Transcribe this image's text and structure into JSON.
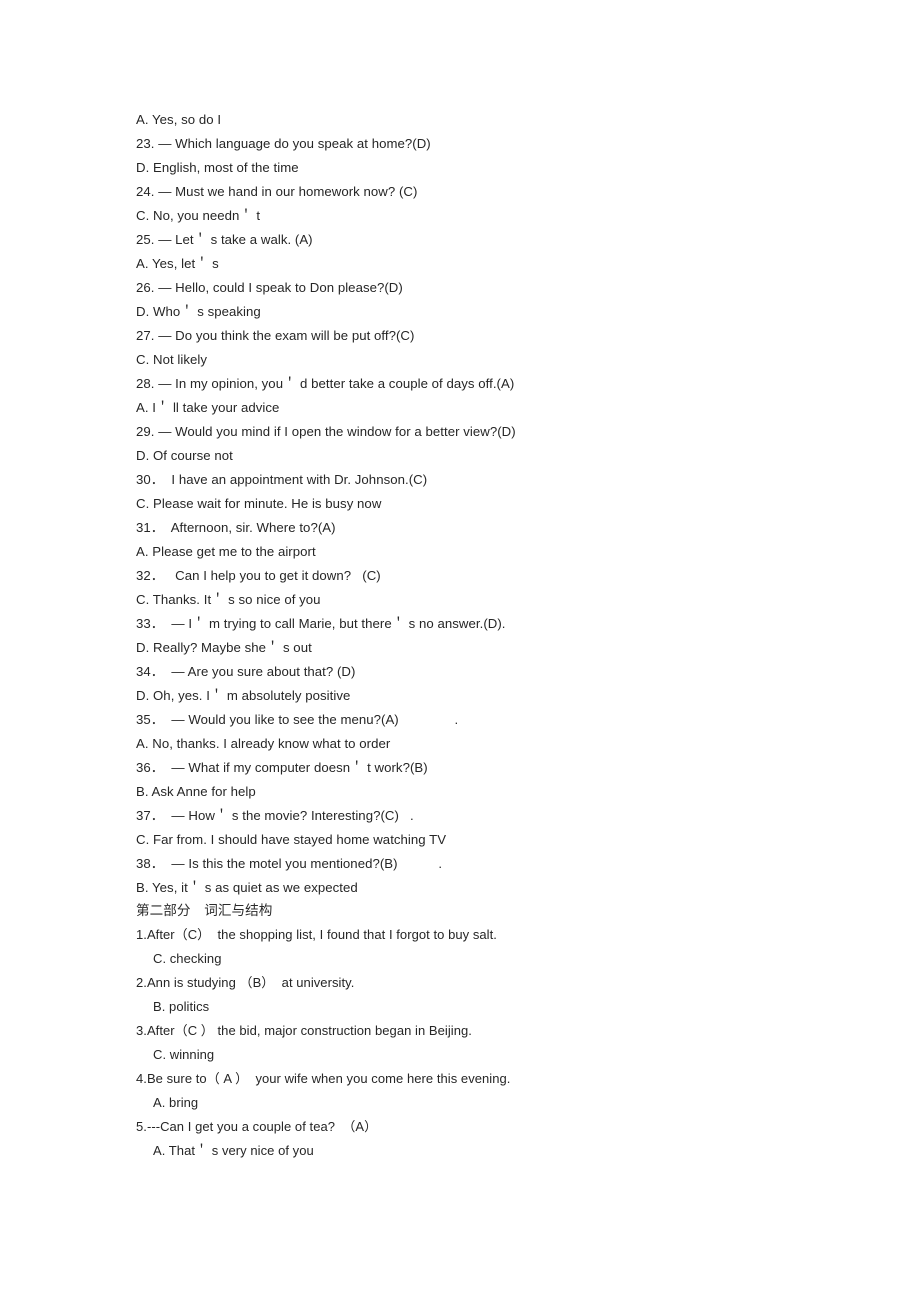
{
  "document": {
    "page_background": "#ffffff",
    "text_color": "#262626",
    "part_one_lines": [
      {
        "id": "opt-22-a",
        "text": "A. Yes, so do I",
        "kind": "option"
      },
      {
        "id": "q-23",
        "text": "23. — Which language do you speak at home?(D)",
        "kind": "question"
      },
      {
        "id": "opt-23-d",
        "text": "D. English, most of the time",
        "kind": "option"
      },
      {
        "id": "q-24",
        "text": "24. — Must we hand in our homework now? (C)",
        "kind": "question"
      },
      {
        "id": "opt-24-c",
        "text": "C. No, you needn＇ t",
        "kind": "option"
      },
      {
        "id": "q-25",
        "text": "25. — Let＇ s take a walk. (A)",
        "kind": "question"
      },
      {
        "id": "opt-25-a",
        "text": "A. Yes, let＇ s",
        "kind": "option"
      },
      {
        "id": "q-26",
        "text": "26. — Hello, could I speak to Don please?(D)",
        "kind": "question"
      },
      {
        "id": "opt-26-d",
        "text": "D. Who＇ s speaking",
        "kind": "option"
      },
      {
        "id": "q-27",
        "text": "27. — Do you think the exam will be put off?(C)",
        "kind": "question"
      },
      {
        "id": "opt-27-c",
        "text": "C. Not likely",
        "kind": "option"
      },
      {
        "id": "q-28",
        "text": "28. — In my opinion, you＇ d better take a couple of days off.(A)",
        "kind": "question"
      },
      {
        "id": "opt-28-a",
        "text": "A. I＇ ll take your advice",
        "kind": "option"
      },
      {
        "id": "q-29",
        "text": "29. — Would you mind if I open the window for a better view?(D)",
        "kind": "question"
      },
      {
        "id": "opt-29-d",
        "text": "D. Of course not",
        "kind": "option"
      },
      {
        "id": "q-30",
        "text": "30．  I have an appointment with Dr. Johnson.(C)",
        "kind": "question"
      },
      {
        "id": "opt-30-c",
        "text": "C. Please wait for minute. He is busy now",
        "kind": "option"
      },
      {
        "id": "q-31",
        "text": "31．  Afternoon, sir. Where to?(A)",
        "kind": "question"
      },
      {
        "id": "opt-31-a",
        "text": "A. Please get me to the airport",
        "kind": "option"
      },
      {
        "id": "q-32",
        "text": "32．   Can I help you to get it down?   (C)",
        "kind": "question"
      },
      {
        "id": "opt-32-c",
        "text": "C. Thanks. It＇ s so nice of you",
        "kind": "option"
      },
      {
        "id": "q-33",
        "text": "33．  — I＇ m trying to call Marie, but there＇ s no answer.(D).",
        "kind": "question"
      },
      {
        "id": "opt-33-d",
        "text": "D. Really? Maybe she＇ s out",
        "kind": "option"
      },
      {
        "id": "q-34",
        "text": "34．  — Are you sure about that? (D)",
        "kind": "question"
      },
      {
        "id": "opt-34-d",
        "text": "D. Oh, yes. I＇ m absolutely positive",
        "kind": "option"
      },
      {
        "id": "q-35",
        "text": "35．  — Would you like to see the menu?(A)               .",
        "kind": "question"
      },
      {
        "id": "opt-35-a",
        "text": "A. No, thanks. I already know what to order",
        "kind": "option"
      },
      {
        "id": "q-36",
        "text": "36．  — What if my computer doesn＇ t work?(B)",
        "kind": "question"
      },
      {
        "id": "opt-36-b",
        "text": "B. Ask Anne for help",
        "kind": "option"
      },
      {
        "id": "q-37",
        "text": "37．  — How＇ s the movie? Interesting?(C)   .",
        "kind": "question"
      },
      {
        "id": "opt-37-c",
        "text": "C. Far from. I should have stayed home watching TV",
        "kind": "option"
      },
      {
        "id": "q-38",
        "text": "38．  — Is this the motel you mentioned?(B)           .",
        "kind": "question"
      },
      {
        "id": "opt-38-b",
        "text": "B. Yes, it＇ s as quiet as we expected",
        "kind": "option"
      }
    ],
    "part_two_heading": "第二部分　词汇与结构",
    "part_two_lines": [
      {
        "id": "pt2-q1",
        "text": "1.After（C）  the shopping list, I found that I forgot to buy salt.",
        "kind": "question",
        "indent": false
      },
      {
        "id": "pt2-a1",
        "text": "C. checking",
        "kind": "answer",
        "indent": true
      },
      {
        "id": "pt2-q2",
        "text": "2.Ann is studying （B）  at university.",
        "kind": "question",
        "indent": false
      },
      {
        "id": "pt2-a2",
        "text": "B. politics",
        "kind": "answer",
        "indent": true
      },
      {
        "id": "pt2-q3",
        "text": "3.After（C ） the bid, major construction began in Beijing.",
        "kind": "question",
        "indent": false
      },
      {
        "id": "pt2-a3",
        "text": "C. winning",
        "kind": "answer",
        "indent": true
      },
      {
        "id": "pt2-q4",
        "text": "4.Be sure to（ A ）  your wife when you come here this evening.",
        "kind": "question",
        "indent": false
      },
      {
        "id": "pt2-a4",
        "text": "A. bring",
        "kind": "answer",
        "indent": true
      },
      {
        "id": "pt2-q5",
        "text": "5.---Can I get you a couple of tea?  （A）",
        "kind": "question",
        "indent": false
      },
      {
        "id": "pt2-a5",
        "text": "A. That＇ s very nice of you",
        "kind": "answer",
        "indent": true
      }
    ]
  }
}
